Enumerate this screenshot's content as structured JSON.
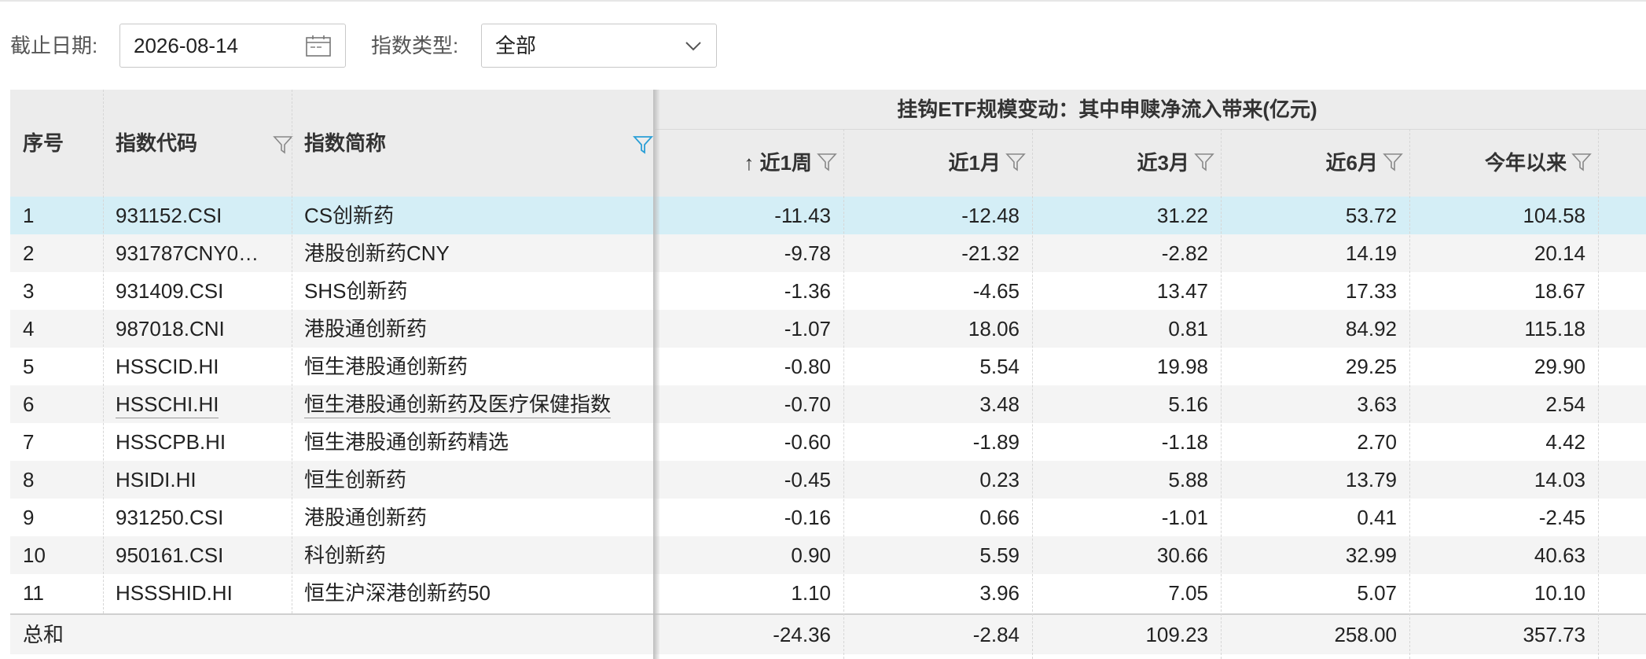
{
  "filters": {
    "date_label": "截止日期:",
    "date_value": "2026-08-14",
    "type_label": "指数类型:",
    "type_value": "全部"
  },
  "table": {
    "group_header": "挂钩ETF规模变动：其中申赎净流入带来(亿元)",
    "columns": {
      "index": "序号",
      "code": "指数代码",
      "name": "指数简称",
      "w1": "↑ 近1周",
      "m1": "近1月",
      "m3": "近3月",
      "m6": "近6月",
      "ytd": "今年以来"
    },
    "rows": [
      {
        "index": "1",
        "code": "931152.CSI",
        "name": "CS创新药",
        "w1": "-11.43",
        "m1": "-12.48",
        "m3": "31.22",
        "m6": "53.72",
        "ytd": "104.58"
      },
      {
        "index": "2",
        "code": "931787CNY0…",
        "name": "港股创新药CNY",
        "w1": "-9.78",
        "m1": "-21.32",
        "m3": "-2.82",
        "m6": "14.19",
        "ytd": "20.14"
      },
      {
        "index": "3",
        "code": "931409.CSI",
        "name": "SHS创新药",
        "w1": "-1.36",
        "m1": "-4.65",
        "m3": "13.47",
        "m6": "17.33",
        "ytd": "18.67"
      },
      {
        "index": "4",
        "code": "987018.CNI",
        "name": "港股通创新药",
        "w1": "-1.07",
        "m1": "18.06",
        "m3": "0.81",
        "m6": "84.92",
        "ytd": "115.18"
      },
      {
        "index": "5",
        "code": "HSSCID.HI",
        "name": "恒生港股通创新药",
        "w1": "-0.80",
        "m1": "5.54",
        "m3": "19.98",
        "m6": "29.25",
        "ytd": "29.90"
      },
      {
        "index": "6",
        "code": "HSSCHI.HI",
        "name": "恒生港股通创新药及医疗保健指数",
        "w1": "-0.70",
        "m1": "3.48",
        "m3": "5.16",
        "m6": "3.63",
        "ytd": "2.54"
      },
      {
        "index": "7",
        "code": "HSSCPB.HI",
        "name": "恒生港股通创新药精选",
        "w1": "-0.60",
        "m1": "-1.89",
        "m3": "-1.18",
        "m6": "2.70",
        "ytd": "4.42"
      },
      {
        "index": "8",
        "code": "HSIDI.HI",
        "name": "恒生创新药",
        "w1": "-0.45",
        "m1": "0.23",
        "m3": "5.88",
        "m6": "13.79",
        "ytd": "14.03"
      },
      {
        "index": "9",
        "code": "931250.CSI",
        "name": "港股通创新药",
        "w1": "-0.16",
        "m1": "0.66",
        "m3": "-1.01",
        "m6": "0.41",
        "ytd": "-2.45"
      },
      {
        "index": "10",
        "code": "950161.CSI",
        "name": "科创新药",
        "w1": "0.90",
        "m1": "5.59",
        "m3": "30.66",
        "m6": "32.99",
        "ytd": "40.63"
      },
      {
        "index": "11",
        "code": "HSSSHID.HI",
        "name": "恒生沪深港创新药50",
        "w1": "1.10",
        "m1": "3.96",
        "m3": "7.05",
        "m6": "5.07",
        "ytd": "10.10"
      }
    ],
    "total": {
      "label": "总和",
      "w1": "-24.36",
      "m1": "-2.84",
      "m3": "109.23",
      "m6": "258.00",
      "ytd": "357.73"
    }
  },
  "colors": {
    "selected_row": "#d4eef6",
    "active_filter_icon": "#2a9fd6",
    "header_bg": "#ececec"
  }
}
